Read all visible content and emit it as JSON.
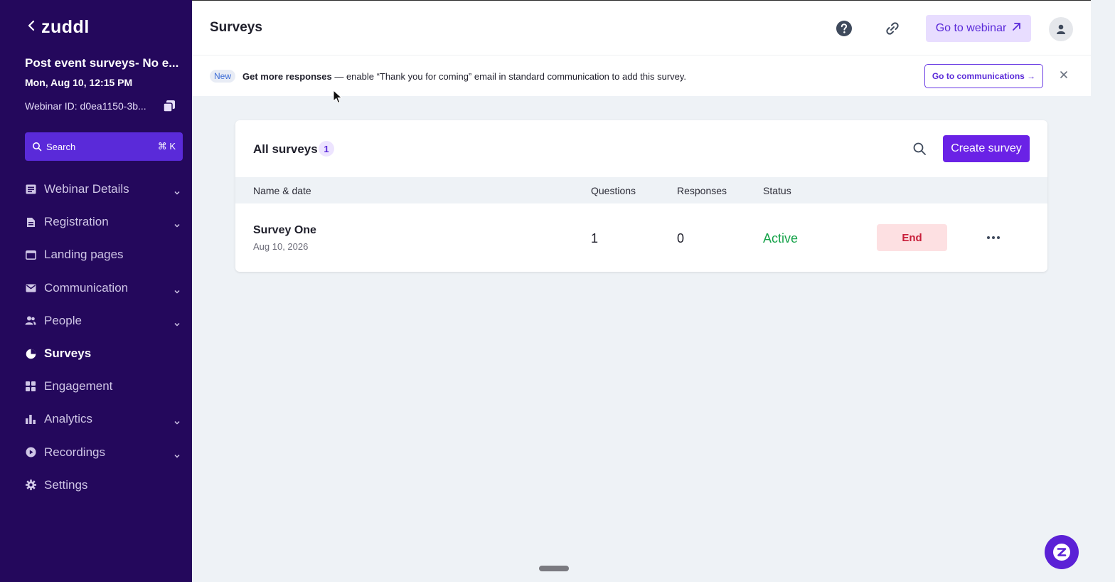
{
  "sidebar": {
    "back_icon": "chevron-left-icon",
    "logo": "zuddl",
    "event_title": "Post event surveys- No e...",
    "event_date": "Mon, Aug 10, 12:15 PM",
    "webinar_id": "Webinar ID: d0ea1150-3b...",
    "search": {
      "label": "Search",
      "shortcut": "⌘ K"
    },
    "items": [
      {
        "label": "Webinar Details",
        "icon": "document-icon",
        "expandable": true
      },
      {
        "label": "Registration",
        "icon": "clipboard-icon",
        "expandable": true
      },
      {
        "label": "Landing pages",
        "icon": "browser-icon",
        "expandable": false
      },
      {
        "label": "Communication",
        "icon": "mail-icon",
        "expandable": true
      },
      {
        "label": "People",
        "icon": "people-icon",
        "expandable": true
      },
      {
        "label": "Surveys",
        "icon": "pie-icon",
        "expandable": false,
        "active": true
      },
      {
        "label": "Engagement",
        "icon": "grid-icon",
        "expandable": false
      },
      {
        "label": "Analytics",
        "icon": "bar-chart-icon",
        "expandable": true
      },
      {
        "label": "Recordings",
        "icon": "play-icon",
        "expandable": true
      },
      {
        "label": "Settings",
        "icon": "gear-icon",
        "expandable": false
      }
    ]
  },
  "header": {
    "title": "Surveys",
    "go_webinar": "Go to webinar"
  },
  "banner": {
    "badge": "New",
    "bold_text": "Get more responses",
    "text": " — enable “Thank you for coming” email in standard communication to add this survey.",
    "button": "Go to communications →"
  },
  "surveys": {
    "title": "All surveys",
    "count": "1",
    "create_label": "Create survey",
    "columns": {
      "name": "Name & date",
      "questions": "Questions",
      "responses": "Responses",
      "status": "Status"
    },
    "rows": [
      {
        "name": "Survey One",
        "date": "Aug 10, 2026",
        "questions": "1",
        "responses": "0",
        "status": "Active",
        "action": "End"
      }
    ]
  },
  "colors": {
    "sidebar_bg": "#24085c",
    "accent": "#6a22e6",
    "status_active": "#16a34a",
    "end_bg": "#fde0e2",
    "end_text": "#c81e3a"
  }
}
